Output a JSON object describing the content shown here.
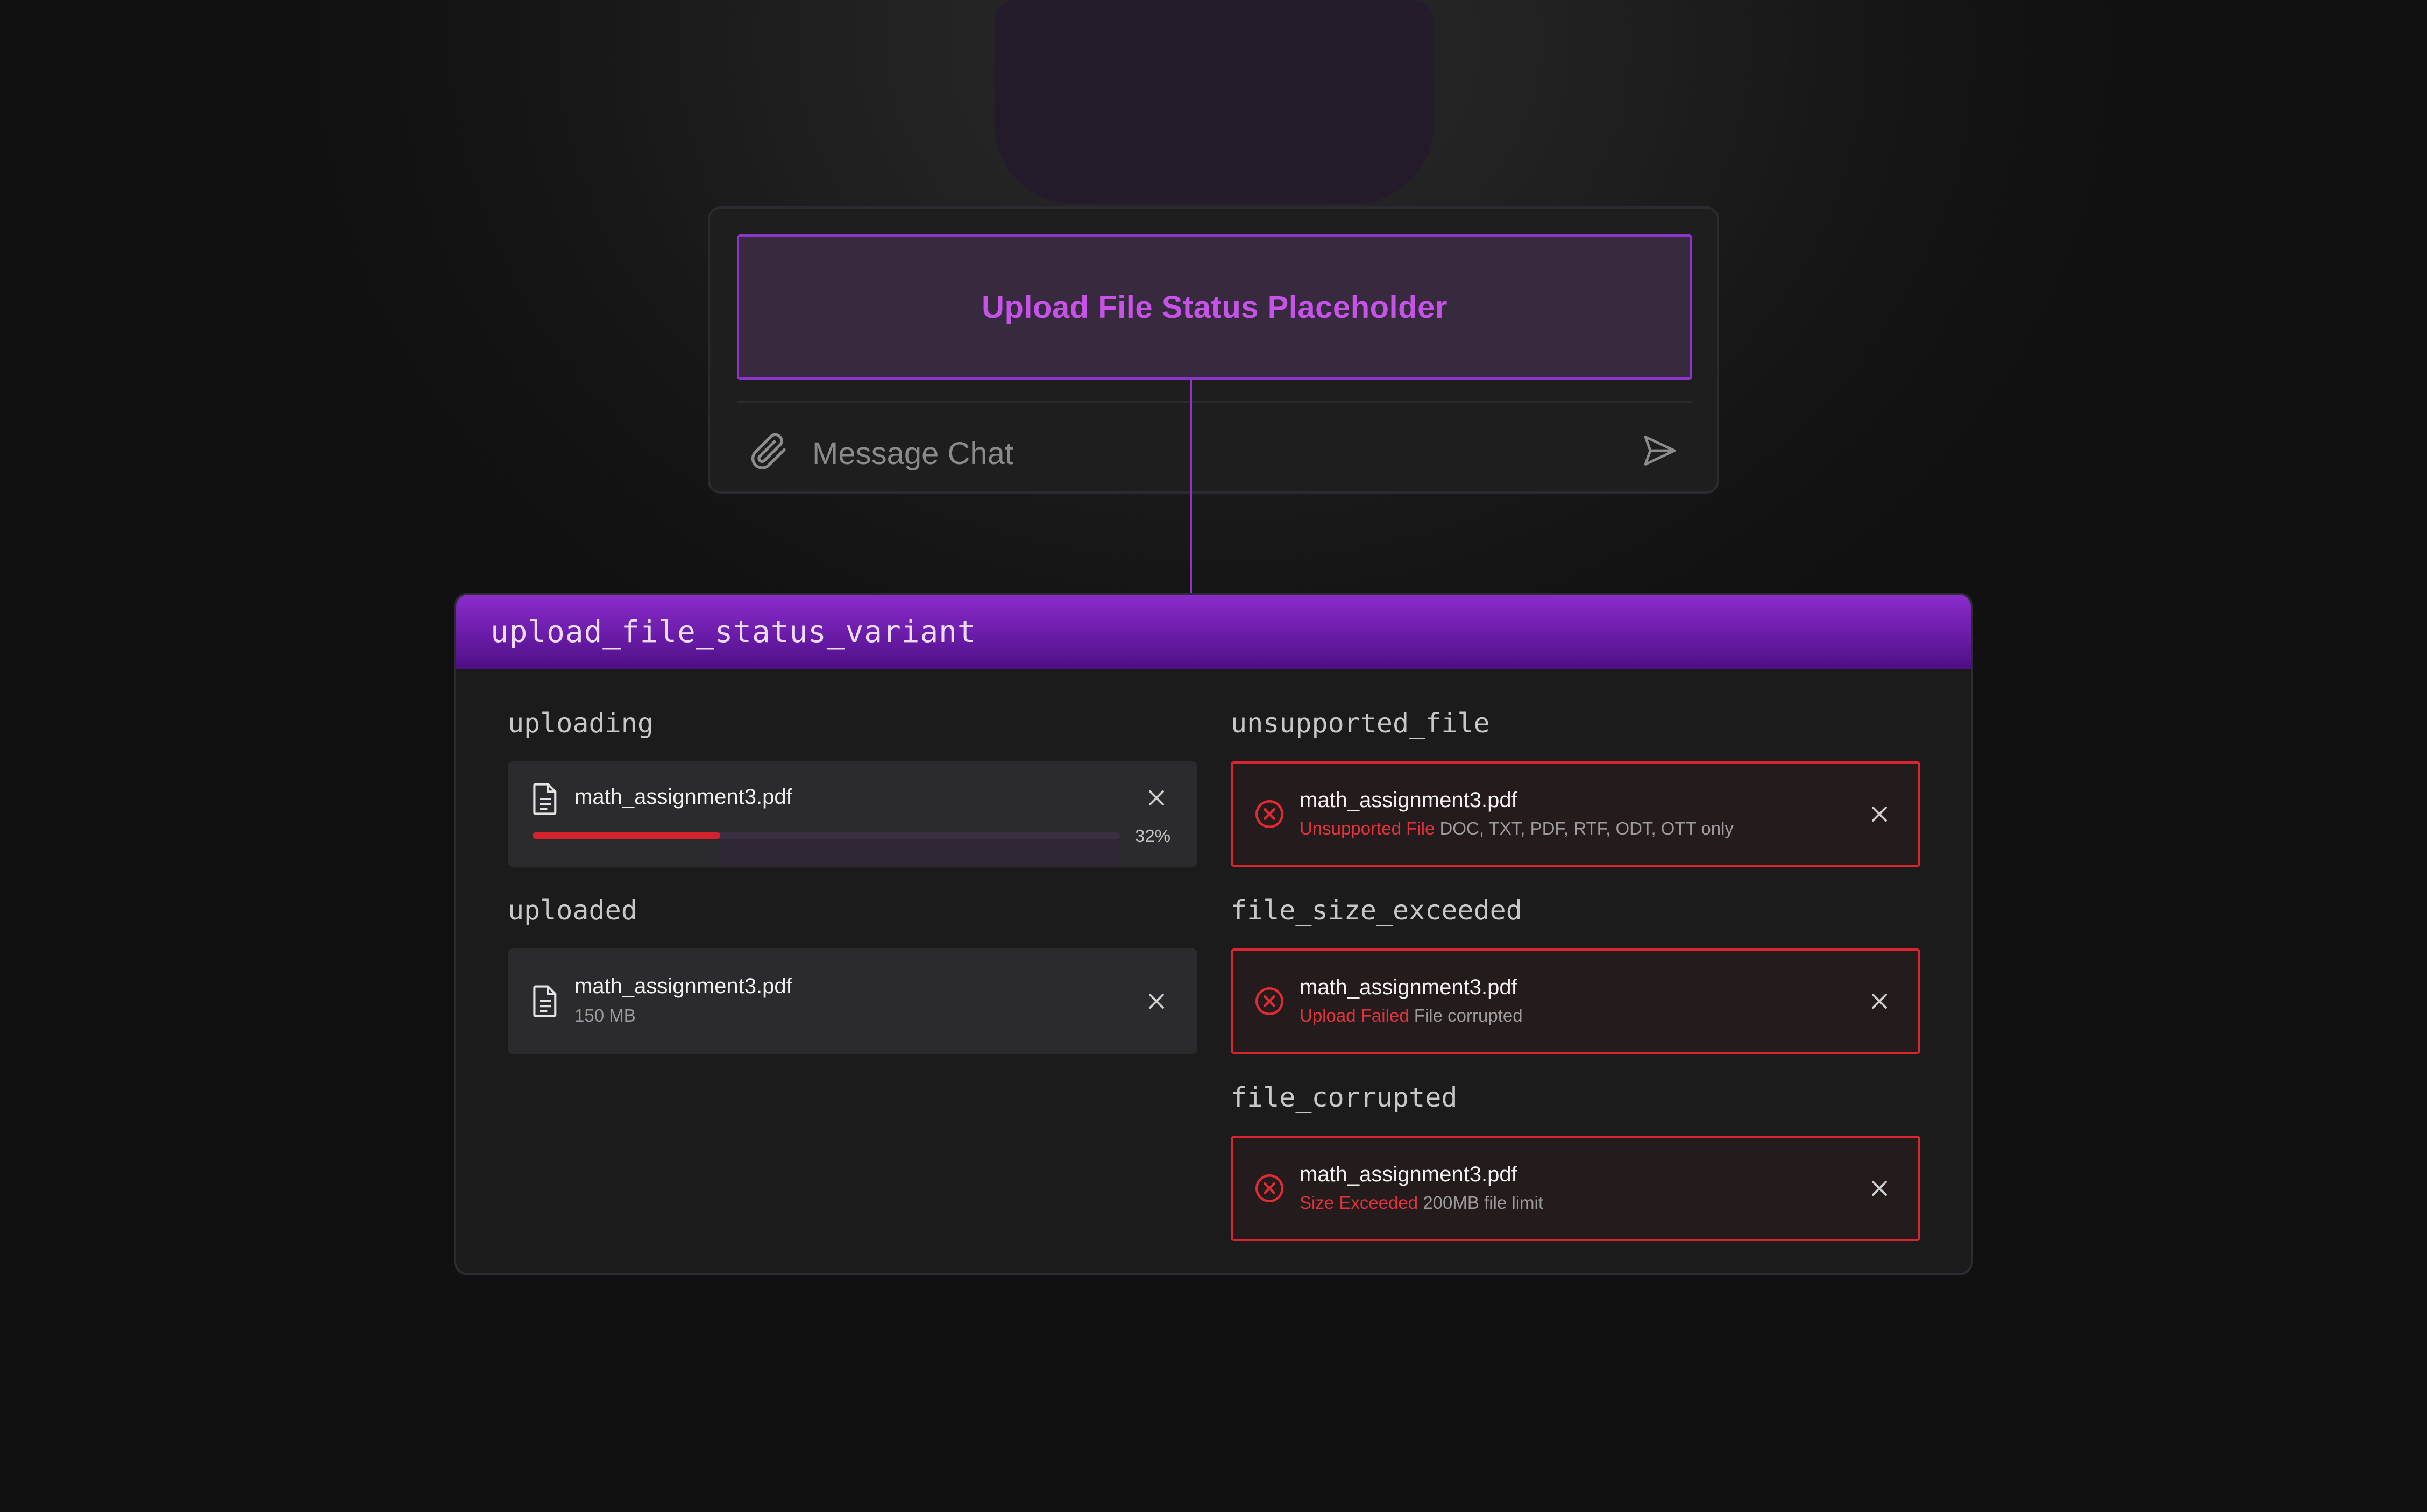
{
  "colors": {
    "accent_purple": "#8c36c9",
    "placeholder_text": "#c752e8",
    "error_red": "#d8252f",
    "progress_fill": "#d3222c",
    "panel_bg": "#1b1b1c"
  },
  "composer": {
    "placeholder_box_label": "Upload File Status Placeholder",
    "message_placeholder": "Message Chat",
    "attach_icon": "paperclip-icon",
    "send_icon": "send-icon"
  },
  "variant_panel": {
    "title": "upload_file_status_variant",
    "uploading": {
      "label": "uploading",
      "file_name": "math_assignment3.pdf",
      "progress_percent": 32,
      "progress_label": "32%",
      "icon": "document-icon"
    },
    "uploaded": {
      "label": "uploaded",
      "file_name": "math_assignment3.pdf",
      "size": "150 MB",
      "icon": "document-icon"
    },
    "unsupported_file": {
      "label": "unsupported_file",
      "file_name": "math_assignment3.pdf",
      "error_title": "Unsupported File",
      "error_detail": "DOC, TXT, PDF, RTF, ODT, OTT only",
      "icon": "error-circle-icon"
    },
    "file_size_exceeded": {
      "label": "file_size_exceeded",
      "file_name": "math_assignment3.pdf",
      "error_title": "Upload Failed",
      "error_detail": "File corrupted",
      "icon": "error-circle-icon"
    },
    "file_corrupted": {
      "label": "file_corrupted",
      "file_name": "math_assignment3.pdf",
      "error_title": "Size Exceeded",
      "error_detail": "200MB file limit",
      "icon": "error-circle-icon"
    }
  }
}
